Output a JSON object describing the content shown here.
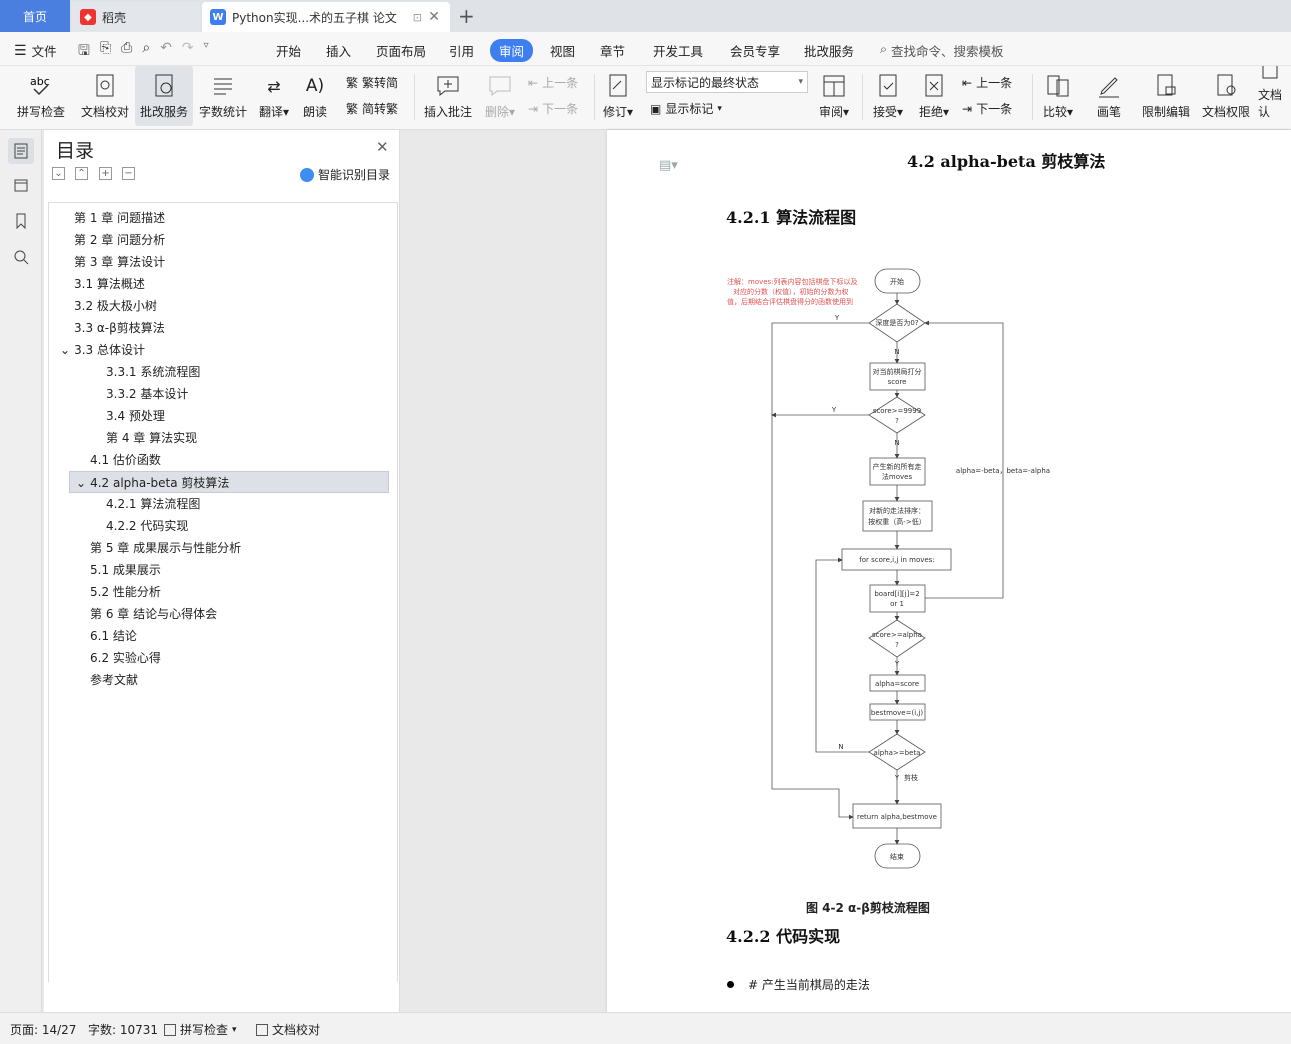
{
  "tabs": {
    "home": "首页",
    "daoke": "稻壳",
    "doc": "Python实现...术的五子棋 论文",
    "add": "+"
  },
  "menu": {
    "file": "文件",
    "items": [
      "开始",
      "插入",
      "页面布局",
      "引用",
      "审阅",
      "视图",
      "章节",
      "开发工具",
      "会员专享",
      "批改服务"
    ],
    "search": "查找命令、搜索模板"
  },
  "toolbar": {
    "spell": "拼写检查",
    "proof": "文档校对",
    "correct": "批改服务",
    "wordcount": "字数统计",
    "translate": "翻译",
    "read": "朗读",
    "trad_to_simp": "繁转简",
    "simp_to_trad": "简转繁",
    "insert_comment": "插入批注",
    "delete": "删除",
    "prev": "上一条",
    "next": "下一条",
    "revise": "修订",
    "markup_select": "显示标记的最终状态",
    "show_markup": "显示标记",
    "review": "审阅",
    "accept": "接受",
    "reject": "拒绝",
    "prev2": "上一条",
    "next2": "下一条",
    "compare": "比较",
    "pen": "画笔",
    "restrict": "限制编辑",
    "permission": "文档权限",
    "doc_cert": "文档认"
  },
  "toc": {
    "title": "目录",
    "smart": "智能识别目录",
    "items": [
      {
        "label": "第 1 章  问题描述",
        "level": 1
      },
      {
        "label": "第 2 章  问题分析",
        "level": 1
      },
      {
        "label": "第 3 章  算法设计",
        "level": 1
      },
      {
        "label": "3.1  算法概述",
        "level": 1
      },
      {
        "label": "3.2  极大极小树",
        "level": 1
      },
      {
        "label": "3.3 α-β剪枝算法",
        "level": 1
      },
      {
        "label": "3.3 总体设计",
        "level": 1
      },
      {
        "label": "3.3.1  系统流程图",
        "level": 3
      },
      {
        "label": "3.3.2  基本设计",
        "level": 3
      },
      {
        "label": "3.4  预处理",
        "level": 3
      },
      {
        "label": "第 4 章  算法实现",
        "level": 3
      },
      {
        "label": "4.1  估价函数",
        "level": 2
      },
      {
        "label": "4.2 alpha-beta 剪枝算法",
        "level": 2
      },
      {
        "label": "4.2.1  算法流程图",
        "level": 3
      },
      {
        "label": "4.2.2  代码实现",
        "level": 3
      },
      {
        "label": "第 5 章  成果展示与性能分析",
        "level": 2
      },
      {
        "label": "5.1  成果展示",
        "level": 2
      },
      {
        "label": "5.2  性能分析",
        "level": 2
      },
      {
        "label": "第 6 章  结论与心得体会",
        "level": 2
      },
      {
        "label": "6.1  结论",
        "level": 2
      },
      {
        "label": "6.2  实验心得",
        "level": 2
      },
      {
        "label": "参考文献",
        "level": 2
      }
    ]
  },
  "document": {
    "h_42": "4.2 alpha-beta 剪枝算法",
    "h_421": "4.2.1  算法流程图",
    "h_422": "4.2.2  代码实现",
    "caption": "图  4-2 α-β剪枝流程图",
    "bullet": "# 产生当前棋局的走法",
    "flow": {
      "note": [
        "注解：moves:列表内容包括棋盘下标以及",
        "对应的分数（权值），初始的分数为权",
        "值，后期结合评估棋盘得分的函数使用到"
      ],
      "start": "开始",
      "depth": "深度是否为0?",
      "evaluate": [
        "对当前棋局打分",
        "score"
      ],
      "score_check": [
        "score>=9999",
        "?"
      ],
      "gen": [
        "产生新的所有走",
        "法moves"
      ],
      "sort": [
        "对新的走法排序：",
        "按权重（高->低）"
      ],
      "loop": "for score,i,j in moves:",
      "board": [
        "board[i][j]=2",
        "or 1"
      ],
      "alpha_check": [
        "score>=alpha",
        "?"
      ],
      "alpha_assign": "alpha=score",
      "bestmove": "bestmove=(i,j)",
      "beta_check": "alpha>=beta",
      "return": "return alpha,bestmove",
      "end": "结束",
      "y": "Y",
      "n": "N",
      "prune": "剪枝",
      "recursion": "alpha=-beta，beta=-alpha"
    }
  },
  "status": {
    "page": "页面: 14/27",
    "words": "字数: 10731",
    "spell": "拼写检查",
    "proof": "文档校对"
  },
  "colors": {
    "accent": "#3d7ef0",
    "note_red": "#e05050"
  }
}
